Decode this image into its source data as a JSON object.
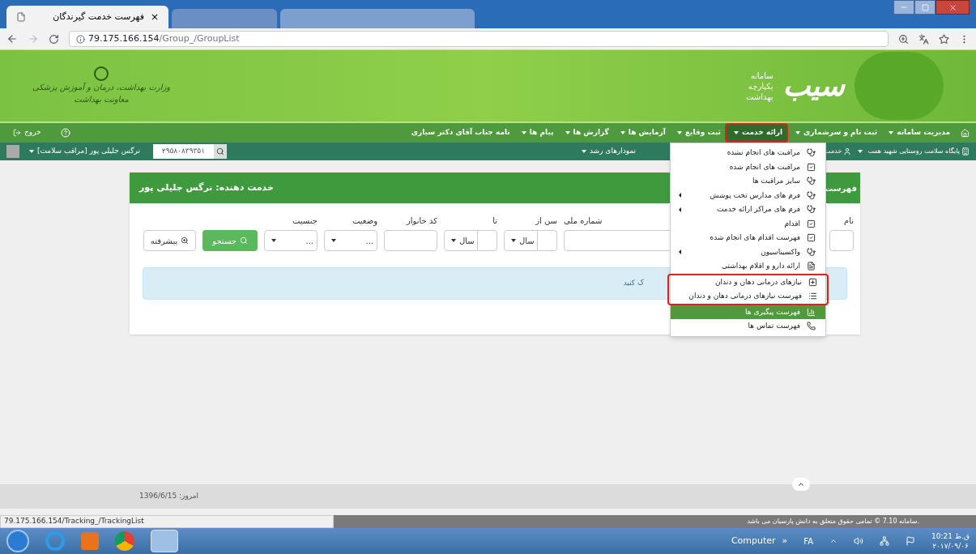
{
  "browser": {
    "tab_title": "فهرست خدمت گیرندگان",
    "tab_close": "×",
    "url_host": "79.175.166.154",
    "url_path": "/Group_/GroupList"
  },
  "banner": {
    "ministry_lines": [
      "وزارت بهداشت، درمان و آموزش پزشکی",
      "معاونت بهداشت"
    ],
    "system_lines": [
      "سامانه",
      "یکپارچه",
      "بهداشت"
    ],
    "logo_text": "سیب"
  },
  "nav": {
    "items": [
      {
        "label": "مدیریت سامانه",
        "kind": "dropdown",
        "selected": false
      },
      {
        "label": "ثبت نام و سرشماری",
        "kind": "dropdown",
        "selected": false
      },
      {
        "label": "ارائه خدمت",
        "kind": "dropdown",
        "selected": true
      },
      {
        "label": "ثبت وقایع",
        "kind": "dropdown",
        "selected": false
      },
      {
        "label": "آزمایش ها",
        "kind": "dropdown",
        "selected": false
      },
      {
        "label": "گزارش ها",
        "kind": "dropdown",
        "selected": false
      },
      {
        "label": "پیام ها",
        "kind": "dropdown",
        "selected": false
      },
      {
        "label": "نامه جناب آقای دکتر سیاری",
        "kind": "link",
        "selected": false
      }
    ],
    "logout": "خروج"
  },
  "subnav": {
    "items": [
      {
        "label": "پایگاه سلامت روستایی شهید همت",
        "kind": "place"
      },
      {
        "label": "خدمت",
        "kind": "user"
      }
    ],
    "growth": "نمودارهای رشد",
    "user": "نرگس جلیلی پور [مراقب سلامت]",
    "search_value": "۲۹۵۸۰۸۳۹۳۵۱"
  },
  "panel": {
    "title": "خدمت دهنده: نرگس جلیلی پور",
    "side_title": "فهرست",
    "fields": [
      {
        "kind": "text",
        "label": "نام"
      },
      {
        "kind": "text",
        "label": "شماره ملی"
      },
      {
        "kind": "age",
        "label": "سن از",
        "unit": "سال"
      },
      {
        "kind": "age",
        "label": "تا",
        "unit": "سال"
      },
      {
        "kind": "text",
        "label": "کد خانوار"
      },
      {
        "kind": "select",
        "label": "وضعیت",
        "value": "..."
      },
      {
        "kind": "select",
        "label": "جنسیت",
        "value": "..."
      }
    ],
    "search_button": "جستجو",
    "advanced_button": "پیشرفته",
    "alert": "ک کنید"
  },
  "menu": {
    "items": [
      {
        "kind": "stethoscope",
        "label": "مراقبت های انجام نشده",
        "submenu": false,
        "selected": false,
        "annotated": false
      },
      {
        "kind": "check",
        "label": "مراقبت های انجام شده",
        "submenu": false,
        "selected": false,
        "annotated": false
      },
      {
        "kind": "stethoscope",
        "label": "سایر مراقبت ها",
        "submenu": false,
        "selected": false,
        "annotated": false
      },
      {
        "kind": "stethoscope",
        "label": "فرم های مدارس تحت پوشش",
        "submenu": true,
        "selected": false,
        "annotated": false
      },
      {
        "kind": "stethoscope",
        "label": "فرم های مراکز ارائه خدمت",
        "submenu": true,
        "selected": false,
        "annotated": false
      },
      {
        "kind": "check",
        "label": "اقدام",
        "submenu": false,
        "selected": false,
        "annotated": false
      },
      {
        "kind": "check",
        "label": "فهرست اقدام های انجام شده",
        "submenu": false,
        "selected": false,
        "annotated": false
      },
      {
        "kind": "stethoscope",
        "label": "واکسیناسیون",
        "submenu": true,
        "selected": false,
        "annotated": false
      },
      {
        "kind": "document",
        "label": "ارائه دارو و اقلام بهداشتی",
        "submenu": false,
        "selected": false,
        "annotated": false
      },
      {
        "kind": "plus",
        "label": "نیازهای درمانی دهان و دندان",
        "submenu": false,
        "selected": false,
        "annotated": true
      },
      {
        "kind": "list",
        "label": "فهرست نیازهای درمانی دهان و دندان",
        "submenu": false,
        "selected": false,
        "annotated": true
      },
      {
        "kind": "chart",
        "label": "فهرست پیگیری ها",
        "submenu": false,
        "selected": true,
        "annotated": false
      },
      {
        "kind": "phone",
        "label": "فهرست تماس ها",
        "submenu": false,
        "selected": false,
        "annotated": false
      }
    ]
  },
  "footer": {
    "today": "امروز: 1396/6/15",
    "copyright": "سامانه 7.10 © تمامی حقوق متعلق به دانش پارسیان می باشد.",
    "status_url": "79.175.166.154/Tracking_/TrackingList"
  },
  "taskbar": {
    "toolbar": "Computer",
    "chevron": "»",
    "lang": "FA",
    "time": "10:21 ق.ظ",
    "date": "۲۰۱۷/۰۹/۰۶"
  }
}
